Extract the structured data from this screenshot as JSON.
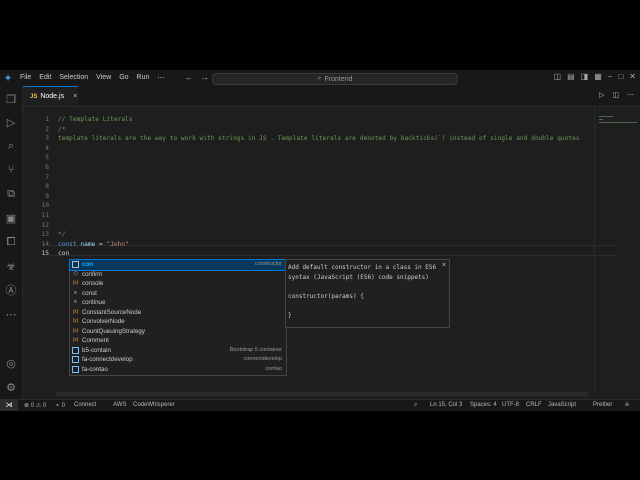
{
  "titlebar": {
    "menu": [
      "File",
      "Edit",
      "Selection",
      "View",
      "Go",
      "Run",
      "⋯"
    ],
    "search": "Frontend"
  },
  "tab": {
    "icon": "JS",
    "label": "Node.js",
    "close": "×"
  },
  "editor": {
    "line_numbers": [
      "1",
      "2",
      "3",
      "4",
      "5",
      "6",
      "7",
      "8",
      "9",
      "10",
      "11",
      "12",
      "13",
      "14",
      "15"
    ],
    "lines": [
      "// Template Literals",
      "/*",
      "template literals are the way to work with strings in JS . Template literals are denoted by backticks(`) instead of single and double quotes",
      "",
      "",
      "",
      "",
      "",
      "",
      "",
      "",
      "",
      "*/",
      "",
      ""
    ],
    "line14": {
      "kw": "const",
      "var": "name",
      "op": " = ",
      "str": "\"John\""
    },
    "line15": "con"
  },
  "suggest": {
    "items": [
      {
        "label": "con",
        "detail": "constructor",
        "icon": "snippet"
      },
      {
        "label": "confirm",
        "detail": "",
        "icon": "method"
      },
      {
        "label": "console",
        "detail": "",
        "icon": "var"
      },
      {
        "label": "const",
        "detail": "",
        "icon": "keyword"
      },
      {
        "label": "continue",
        "detail": "",
        "icon": "keyword"
      },
      {
        "label": "ConstantSourceNode",
        "detail": "",
        "icon": "var"
      },
      {
        "label": "ConvolverNode",
        "detail": "",
        "icon": "var"
      },
      {
        "label": "CountQueuingStrategy",
        "detail": "",
        "icon": "var"
      },
      {
        "label": "Comment",
        "detail": "",
        "icon": "var"
      },
      {
        "label": "b5-contain",
        "detail": "Bootstrap 5 container",
        "icon": "snippet"
      },
      {
        "label": "fa-connectdevelop",
        "detail": "connectdevelop",
        "icon": "snippet"
      },
      {
        "label": "fa-contao",
        "detail": "contao",
        "icon": "snippet"
      }
    ]
  },
  "docs": {
    "description": "Add default constructor in a class in ES6 syntax (JavaScript (ES6) code snippets)",
    "code1": "constructor(params) {",
    "code2": "}",
    "close": "×"
  },
  "status": {
    "errors": "⊗ 0 ⚠ 0",
    "ports": "⚬ 0",
    "connect": "Connect",
    "aws": "AWS",
    "codewhisperer": "CodeWhisperer",
    "position": "Ln 15, Col 3",
    "spaces": "Spaces: 4",
    "encoding": "UTF-8",
    "eol": "CRLF",
    "language": "JavaScript",
    "prettier": "Prettier"
  }
}
